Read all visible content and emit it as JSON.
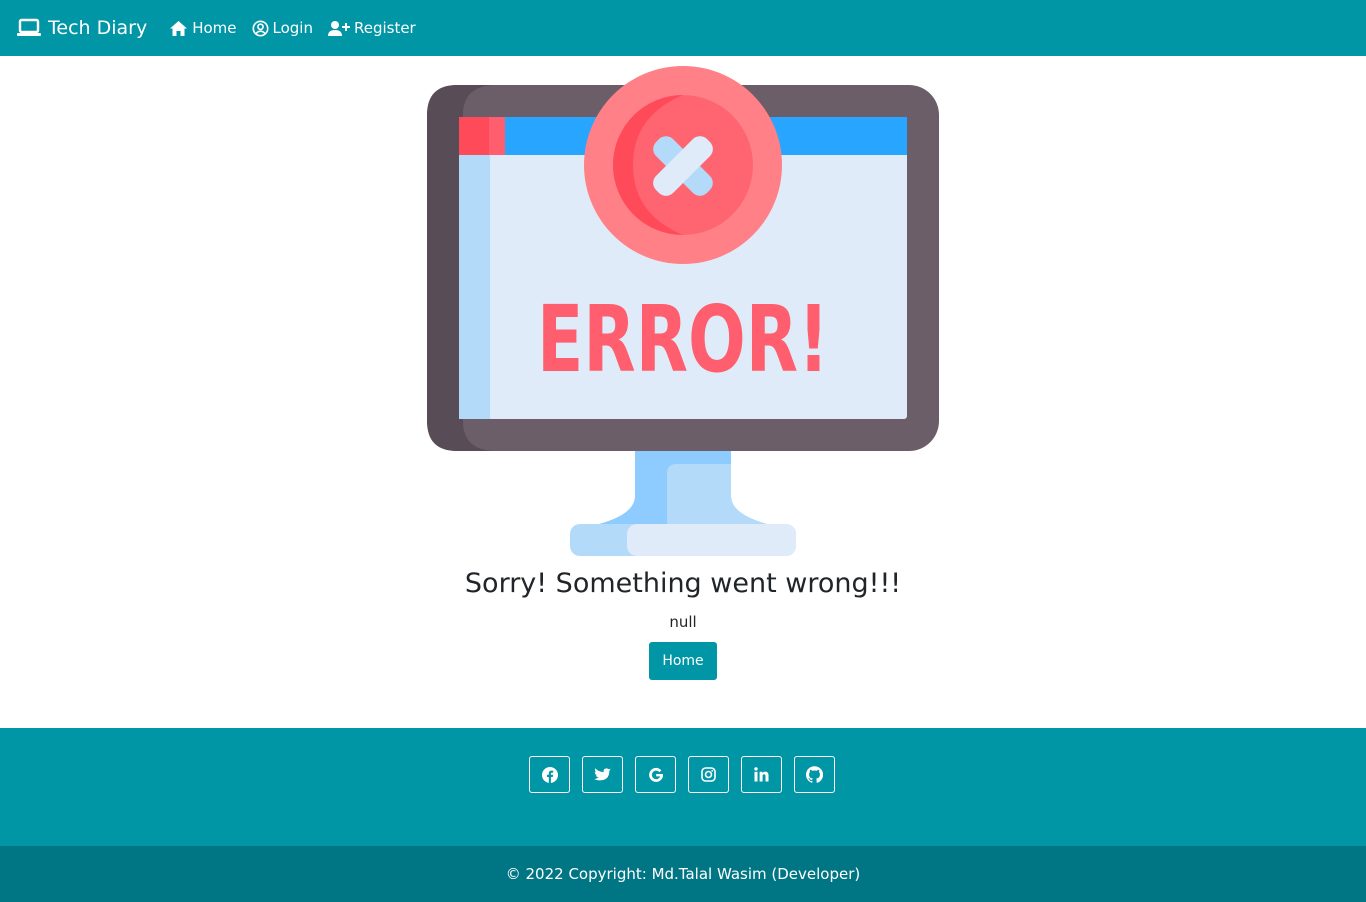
{
  "nav": {
    "brand": "Tech Diary",
    "brand_icon": "laptop-icon",
    "links": [
      {
        "label": "Home",
        "icon": "home-icon"
      },
      {
        "label": "Login",
        "icon": "user-circle-icon"
      },
      {
        "label": "Register",
        "icon": "user-plus-icon"
      }
    ]
  },
  "illustration": {
    "text": "ERROR!",
    "icon": "error-monitor-icon"
  },
  "error": {
    "title": "Sorry! Something went wrong!!!",
    "message": "null",
    "button_label": "Home"
  },
  "footer": {
    "social": [
      {
        "icon": "facebook-icon"
      },
      {
        "icon": "twitter-icon"
      },
      {
        "icon": "google-icon"
      },
      {
        "icon": "instagram-icon"
      },
      {
        "icon": "linkedin-icon"
      },
      {
        "icon": "github-icon"
      }
    ],
    "copyright": "© 2022 Copyright: Md.Talal Wasim (Developer)"
  },
  "colors": {
    "primary": "#0096a6",
    "primary_dark": "#007685",
    "error_red": "#ff5e6e"
  }
}
